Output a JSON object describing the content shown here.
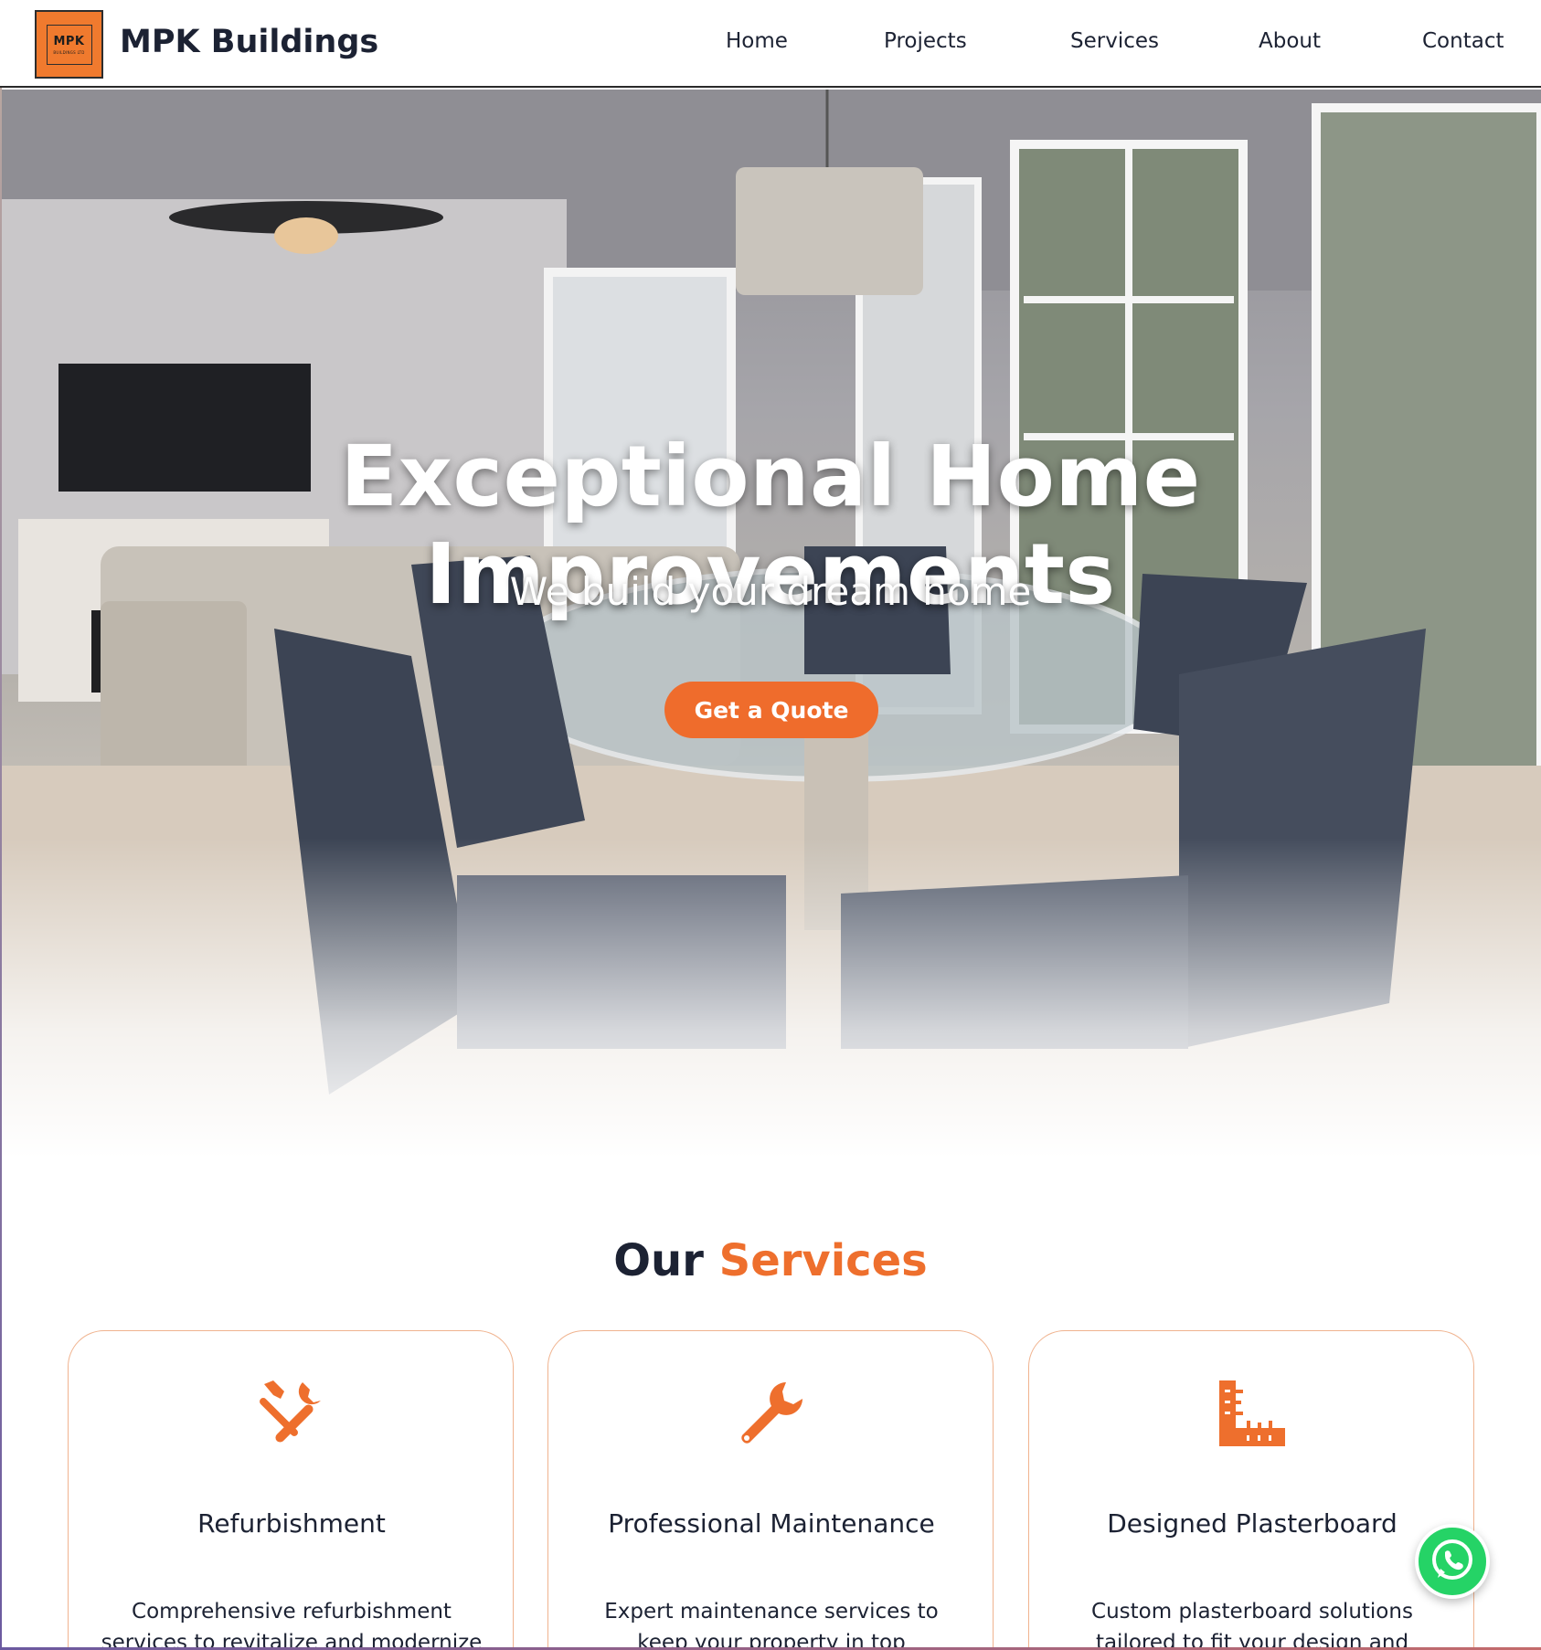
{
  "header": {
    "logo_text": "MPK",
    "logo_subtext": "BUILDINGS LTD",
    "brand": "MPK Buildings",
    "nav": [
      "Home",
      "Projects",
      "Services",
      "About",
      "Contact"
    ]
  },
  "hero": {
    "title": "Exceptional Home Improvements",
    "subtitle": "We build your dream home",
    "cta_label": "Get a Quote"
  },
  "services": {
    "heading_plain": "Our",
    "heading_accent": "Services",
    "cards": [
      {
        "icon": "tools-icon",
        "title": "Refurbishment",
        "desc": "Comprehensive refurbishment services to revitalize and modernize"
      },
      {
        "icon": "wrench-icon",
        "title": "Professional Maintenance",
        "desc": "Expert maintenance services to keep your property in top"
      },
      {
        "icon": "ruler-icon",
        "title": "Designed Plasterboard",
        "desc": "Custom plasterboard solutions tailored to fit your design and"
      }
    ]
  },
  "colors": {
    "accent": "#ee6f2d",
    "text": "#1c2233",
    "whatsapp": "#25d366"
  },
  "floating": {
    "icon": "whatsapp-icon"
  }
}
